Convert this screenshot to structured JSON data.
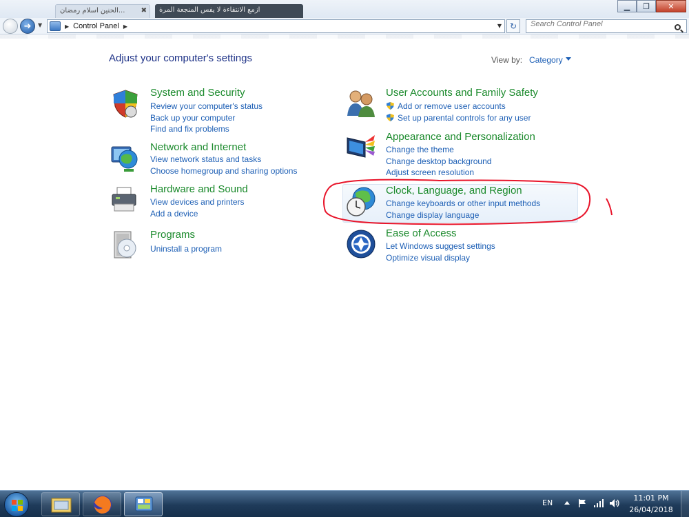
{
  "chrome": {
    "tab1": "الحنين اسلام رمضان...",
    "tab2": "ازمع الانتقاءة لا يفس المنجعة المرة"
  },
  "nav": {
    "address_text": "Control Panel",
    "search_placeholder": "Search Control Panel"
  },
  "main": {
    "title": "Adjust your computer's settings",
    "view_by_label": "View by:",
    "view_by_value": "Category",
    "categories": [
      {
        "title": "System and Security",
        "icon": "shield-icon",
        "links": [
          "Review your computer's status",
          "Back up your computer",
          "Find and fix problems"
        ]
      },
      {
        "title": "Network and Internet",
        "icon": "network-globe-icon",
        "links": [
          "View network status and tasks",
          "Choose homegroup and sharing options"
        ]
      },
      {
        "title": "Hardware and Sound",
        "icon": "printer-icon",
        "links": [
          "View devices and printers",
          "Add a device"
        ]
      },
      {
        "title": "Programs",
        "icon": "programs-disc-icon",
        "links": [
          "Uninstall a program"
        ]
      },
      {
        "title": "User Accounts and Family Safety",
        "icon": "users-icon",
        "links": [
          "Add or remove user accounts",
          "Set up parental controls for any user"
        ]
      },
      {
        "title": "Appearance and Personalization",
        "icon": "monitor-paint-icon",
        "links": [
          "Change the theme",
          "Change desktop background",
          "Adjust screen resolution"
        ]
      },
      {
        "title": "Clock, Language, and Region",
        "icon": "clock-globe-icon",
        "links": [
          "Change keyboards or other input methods",
          "Change display language"
        ]
      },
      {
        "title": "Ease of Access",
        "icon": "ease-of-access-icon",
        "links": [
          "Let Windows suggest settings",
          "Optimize visual display"
        ]
      }
    ]
  },
  "taskbar": {
    "lang": "EN",
    "time": "11:01 PM",
    "date": "26/04/2018"
  },
  "colors": {
    "category_title": "#1b8a2c",
    "link": "#1d5fb5",
    "page_title": "#1e3287",
    "annotation": "#e8142a"
  }
}
